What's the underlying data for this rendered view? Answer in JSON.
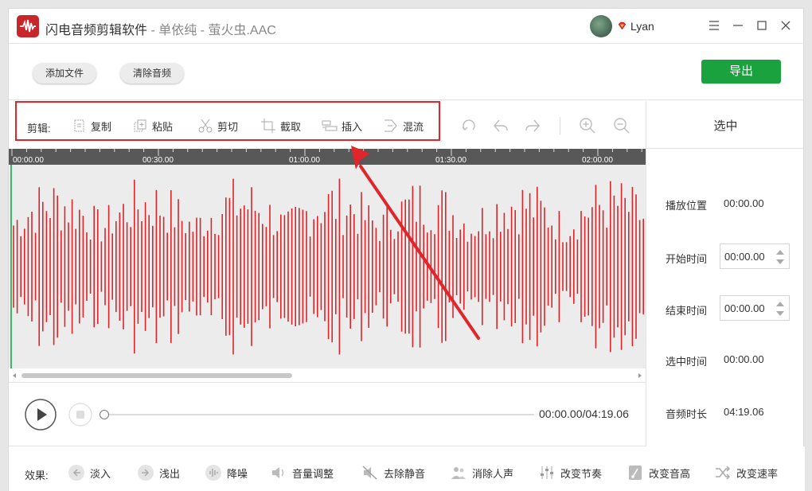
{
  "titlebar": {
    "app_name": "闪电音频剪辑软件",
    "separator": " - ",
    "file_name": "单依纯 - 萤火虫.AAC",
    "user_name": "Lyan"
  },
  "actions": {
    "add_file": "添加文件",
    "clear_audio": "清除音频",
    "export": "导出"
  },
  "edit_toolbar": {
    "label": "剪辑:",
    "copy": "复制",
    "paste": "粘贴",
    "cut": "剪切",
    "crop": "截取",
    "insert": "插入",
    "mix": "混流"
  },
  "timeline": {
    "ticks": [
      "00:00.00",
      "00:30.00",
      "01:00.00",
      "01:30.00",
      "02:00.00"
    ]
  },
  "panel": {
    "header": "选中",
    "play_position_label": "播放位置",
    "play_position_value": "00:00.00",
    "start_time_label": "开始时间",
    "start_time_value": "00:00.00",
    "end_time_label": "结束时间",
    "end_time_value": "00:00.00",
    "selection_time_label": "选中时间",
    "selection_time_value": "00:00.00",
    "duration_label": "音频时长",
    "duration_value": "04:19.06"
  },
  "player": {
    "time_readout": "00:00.00/04:19.06",
    "progress": 0
  },
  "effects": {
    "label": "效果:",
    "fade_in": "淡入",
    "fade_out": "浅出",
    "denoise": "降噪",
    "volume": "音量调整",
    "remove_silence": "去除静音",
    "remove_vocal": "消除人声",
    "tempo": "改变节奏",
    "pitch": "改变音高",
    "speed": "改变速率"
  },
  "colors": {
    "accent_green": "#1aa23e",
    "waveform_red": "#d9262b",
    "highlight_box": "#e0252b",
    "timeline_bar": "#585858"
  }
}
